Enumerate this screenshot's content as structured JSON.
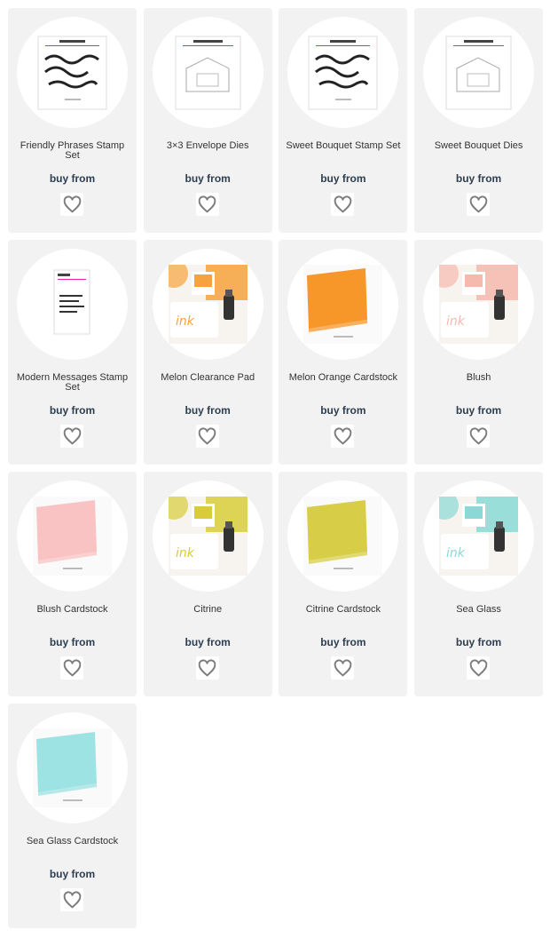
{
  "buy_label": "buy from",
  "products": [
    {
      "title": "Friendly Phrases Stamp Set",
      "image": "stamp-set-thumbnail",
      "art": "stamp"
    },
    {
      "title": "3×3 Envelope Dies",
      "image": "die-set-thumbnail",
      "art": "die"
    },
    {
      "title": "Sweet Bouquet Stamp Set",
      "image": "stamp-set-thumbnail",
      "art": "stamp"
    },
    {
      "title": "Sweet Bouquet Dies",
      "image": "die-set-thumbnail",
      "art": "die"
    },
    {
      "title": "Modern Messages Stamp Set",
      "image": "stamp-set-thumbnail",
      "art": "stamp2"
    },
    {
      "title": "Melon Clearance Pad",
      "image": "ink-pad-thumbnail",
      "art": "ink",
      "color": "#f7a23c"
    },
    {
      "title": "Melon Orange Cardstock",
      "image": "cardstock-thumbnail",
      "art": "card",
      "color": "#f7972a"
    },
    {
      "title": "Blush",
      "image": "ink-pad-thumbnail",
      "art": "ink",
      "color": "#f6b9ae"
    },
    {
      "title": "Blush Cardstock",
      "image": "cardstock-thumbnail",
      "art": "card",
      "color": "#f8c3c2"
    },
    {
      "title": "Citrine",
      "image": "ink-pad-thumbnail",
      "art": "ink",
      "color": "#d8cc3a"
    },
    {
      "title": "Citrine Cardstock",
      "image": "cardstock-thumbnail",
      "art": "card",
      "color": "#d7cd47"
    },
    {
      "title": "Sea Glass",
      "image": "ink-pad-thumbnail",
      "art": "ink",
      "color": "#8ad9d6"
    },
    {
      "title": "Sea Glass Cardstock",
      "image": "cardstock-thumbnail",
      "art": "card",
      "color": "#9ee3e3"
    }
  ],
  "favorite_icon": "heart-icon"
}
